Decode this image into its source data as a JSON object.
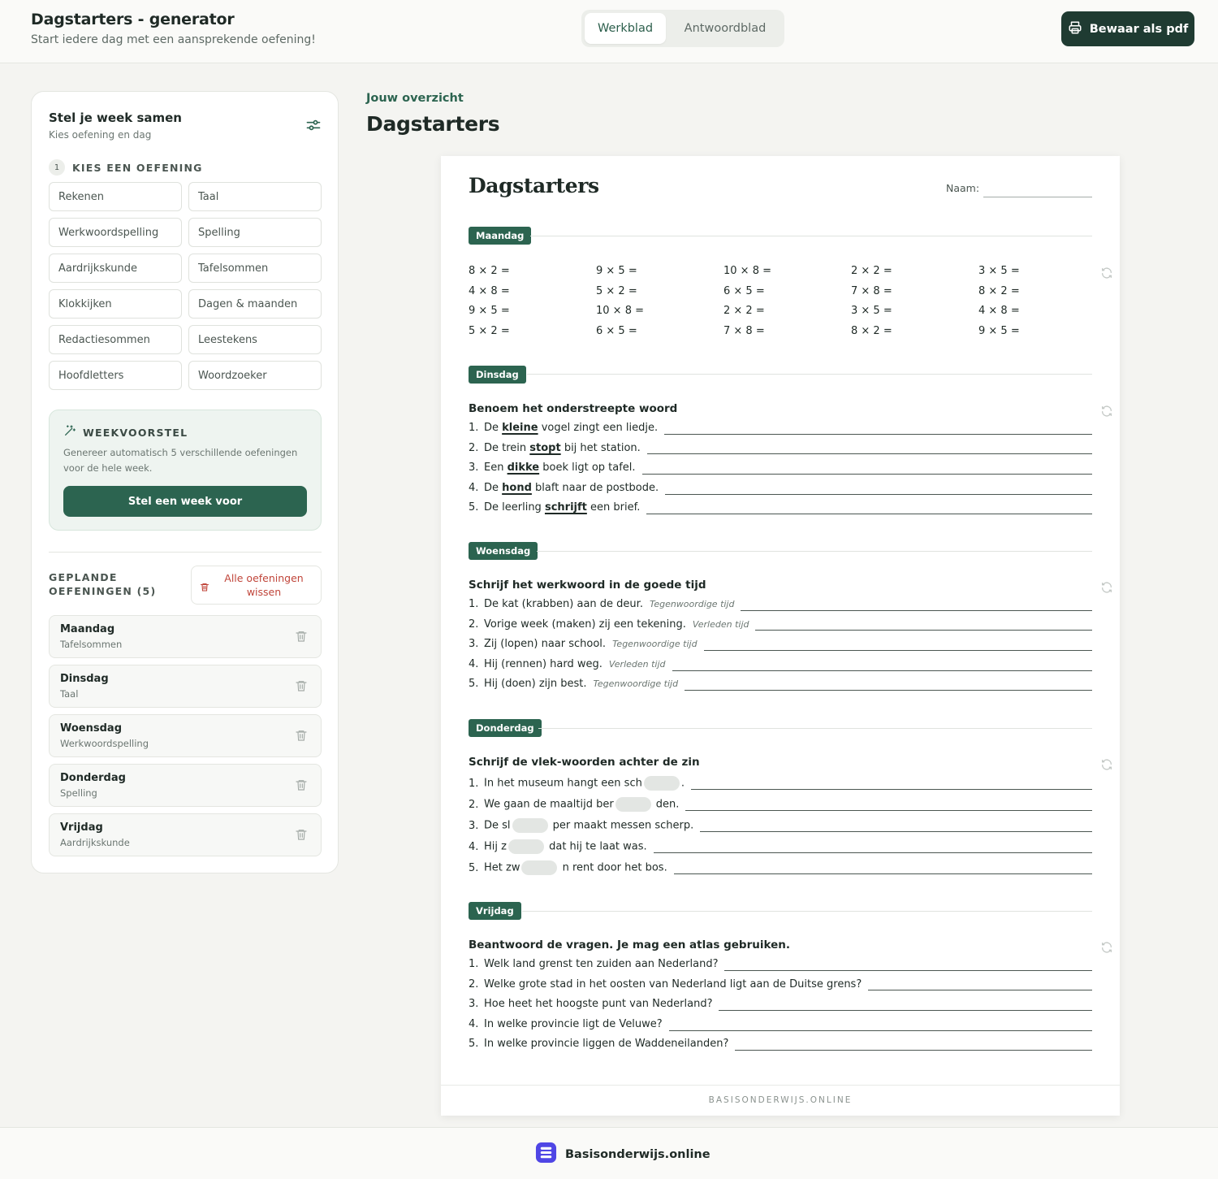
{
  "header": {
    "title": "Dagstarters - generator",
    "subtitle": "Start iedere dag met een aansprekende oefening!",
    "tabs": [
      {
        "label": "Werkblad",
        "active": true
      },
      {
        "label": "Antwoordblad",
        "active": false
      }
    ],
    "pdf_button": "Bewaar als pdf",
    "pdf_icon": "printer-icon"
  },
  "sidebar": {
    "title": "Stel je week samen",
    "subtitle": "Kies oefening en dag",
    "filter_icon": "sliders-icon",
    "step_number": "1",
    "step_label": "KIES EEN OEFENING",
    "exercises": [
      "Rekenen",
      "Taal",
      "Werkwoordspelling",
      "Spelling",
      "Aardrijkskunde",
      "Tafelsommen",
      "Klokkijken",
      "Dagen & maanden",
      "Redactiesommen",
      "Leestekens",
      "Hoofdletters",
      "Woordzoeker"
    ],
    "weekvoorstel": {
      "title": "WEEKVOORSTEL",
      "icon": "magic-wand-icon",
      "description": "Genereer automatisch 5 verschillende oefeningen voor de hele week.",
      "button": "Stel een week voor"
    },
    "planned_label": "GEPLANDE OEFENINGEN (5)",
    "clear_button": "Alle oefeningen wissen",
    "planned": [
      {
        "day": "Maandag",
        "exercise": "Tafelsommen"
      },
      {
        "day": "Dinsdag",
        "exercise": "Taal"
      },
      {
        "day": "Woensdag",
        "exercise": "Werkwoordspelling"
      },
      {
        "day": "Donderdag",
        "exercise": "Spelling"
      },
      {
        "day": "Vrijdag",
        "exercise": "Aardrijkskunde"
      }
    ]
  },
  "main": {
    "overview_label": "Jouw overzicht",
    "title": "Dagstarters"
  },
  "sheet": {
    "title": "Dagstarters",
    "naam_label": "Naam:",
    "footer": "BASISONDERWIJS.ONLINE",
    "days": {
      "maandag": {
        "label": "Maandag",
        "rows": [
          [
            "8 × 2 =",
            "9 × 5 =",
            "10 × 8 =",
            "2 × 2 =",
            "3 × 5 ="
          ],
          [
            "4 × 8 =",
            "5 × 2 =",
            "6 × 5 =",
            "7 × 8 =",
            "8 × 2 ="
          ],
          [
            "9 × 5 =",
            "10 × 8 =",
            "2 × 2 =",
            "3 × 5 =",
            "4 × 8 ="
          ],
          [
            "5 × 2 =",
            "6 × 5 =",
            "7 × 8 =",
            "8 × 2 =",
            "9 × 5 ="
          ]
        ]
      },
      "dinsdag": {
        "label": "Dinsdag",
        "task": "Benoem het onderstreepte woord",
        "items": [
          {
            "num": "1.",
            "pre": "De ",
            "word": "kleine",
            "post": " vogel zingt een liedje."
          },
          {
            "num": "2.",
            "pre": "De trein ",
            "word": "stopt",
            "post": " bij het station."
          },
          {
            "num": "3.",
            "pre": "Een ",
            "word": "dikke",
            "post": " boek ligt op tafel."
          },
          {
            "num": "4.",
            "pre": "De ",
            "word": "hond",
            "post": " blaft naar de postbode."
          },
          {
            "num": "5.",
            "pre": "De leerling ",
            "word": "schrijft",
            "post": " een brief."
          }
        ]
      },
      "woensdag": {
        "label": "Woensdag",
        "task": "Schrijf het werkwoord in de goede tijd",
        "items": [
          {
            "num": "1.",
            "text": "De kat (krabben) aan de deur.",
            "hint": "Tegenwoordige tijd"
          },
          {
            "num": "2.",
            "text": "Vorige week (maken) zij een tekening.",
            "hint": "Verleden tijd"
          },
          {
            "num": "3.",
            "text": "Zij (lopen) naar school.",
            "hint": "Tegenwoordige tijd"
          },
          {
            "num": "4.",
            "text": "Hij (rennen) hard weg.",
            "hint": "Verleden tijd"
          },
          {
            "num": "5.",
            "text": "Hij (doen) zijn best.",
            "hint": "Tegenwoordige tijd"
          }
        ]
      },
      "donderdag": {
        "label": "Donderdag",
        "task": "Schrijf de vlek-woorden achter de zin",
        "items": [
          {
            "num": "1.",
            "pre": "In het museum hangt een sch",
            "post": "."
          },
          {
            "num": "2.",
            "pre": "We gaan de maaltijd ber",
            "post": " den."
          },
          {
            "num": "3.",
            "pre": "De sl",
            "post": " per maakt messen scherp."
          },
          {
            "num": "4.",
            "pre": "Hij z",
            "post": " dat hij te laat was."
          },
          {
            "num": "5.",
            "pre": "Het zw",
            "post": " n rent door het bos."
          }
        ]
      },
      "vrijdag": {
        "label": "Vrijdag",
        "task": "Beantwoord de vragen. Je mag een atlas gebruiken.",
        "items": [
          {
            "num": "1.",
            "text": "Welk land grenst ten zuiden aan Nederland?"
          },
          {
            "num": "2.",
            "text": "Welke grote stad in het oosten van Nederland ligt aan de Duitse grens?"
          },
          {
            "num": "3.",
            "text": "Hoe heet het hoogste punt van Nederland?"
          },
          {
            "num": "4.",
            "text": "In welke provincie ligt de Veluwe?"
          },
          {
            "num": "5.",
            "text": "In welke provincie liggen de Waddeneilanden?"
          }
        ]
      }
    }
  },
  "footer": {
    "brand": "Basisonderwijs.online",
    "brand_color": "#4f46e5"
  }
}
